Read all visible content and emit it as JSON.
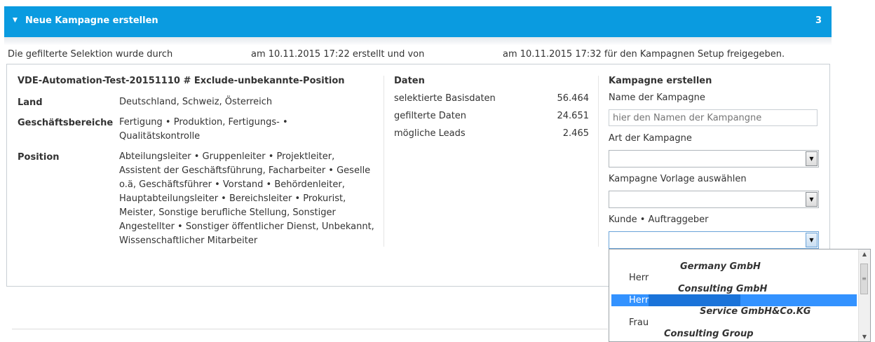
{
  "header": {
    "title": "Neue Kampagne erstellen",
    "step": "3",
    "color": "#0a9be0"
  },
  "info": {
    "part1": "Die gefilterte Selektion wurde durch",
    "part2": "am 10.11.2015 17:22 erstellt und von",
    "part3": "am 10.11.2015 17:32 für den Kampagnen Setup freigegeben."
  },
  "selection": {
    "name": "VDE-Automation-Test-20151110 # Exclude-unbekannte-Position",
    "rows": [
      {
        "label": "Land",
        "value": "Deutschland, Schweiz, Österreich"
      },
      {
        "label": "Geschäftsbereiche",
        "value": "Fertigung • Produktion, Fertigungs- • Qualitätskontrolle"
      },
      {
        "label": "Position",
        "value": "Abteilungsleiter • Gruppenleiter • Projektleiter, Assistent der Geschäftsführung, Facharbeiter • Geselle o.ä, Geschäftsführer • Vorstand • Behördenleiter, Hauptabteilungsleiter • Bereichsleiter • Prokurist, Meister, Sonstige berufliche Stellung, Sonstiger Angestellter • Sonstiger öffentlicher Dienst, Unbekannt, Wissenschaftlicher Mitarbeiter"
      }
    ]
  },
  "daten": {
    "title": "Daten",
    "rows": [
      {
        "label": "selektierte Basisdaten",
        "value": "56.464"
      },
      {
        "label": "gefilterte Daten",
        "value": "24.651"
      },
      {
        "label": "mögliche Leads",
        "value": "2.465"
      }
    ]
  },
  "kampagne": {
    "title": "Kampagne erstellen",
    "name_label": "Name der Kampagne",
    "name_placeholder": "hier den Namen der Kampangne",
    "art_label": "Art der Kampagne",
    "vorlage_label": "Kampagne Vorlage auswählen",
    "kunde_label": "Kunde • Auftraggeber"
  },
  "dropdown": {
    "options": [
      {
        "company": "Germany GmbH",
        "salutation": "Herr"
      },
      {
        "company": "Consulting GmbH",
        "salutation": "Herr",
        "selected": true
      },
      {
        "company": "Service GmbH&Co.KG",
        "salutation": "Frau"
      },
      {
        "company": "Consulting Group",
        "salutation": ""
      }
    ],
    "highlight_color": "#3392ff"
  }
}
